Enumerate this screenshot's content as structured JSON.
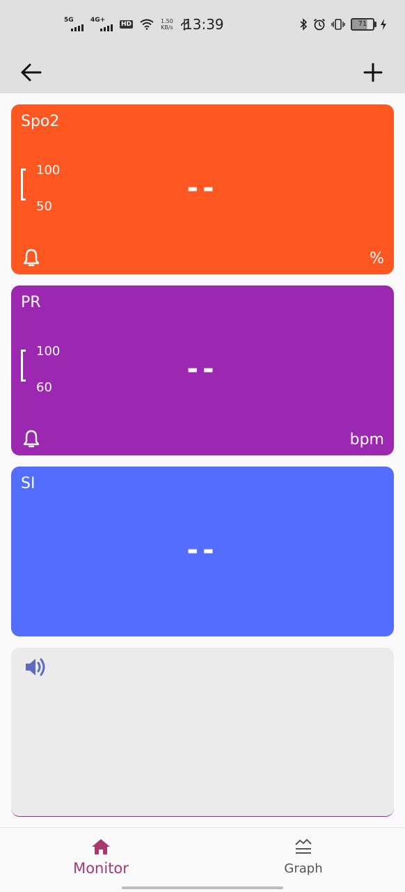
{
  "status_bar": {
    "time": "13:39",
    "network_1": "5G",
    "network_2": "4G+",
    "hd_label": "HD",
    "speed_value": "1.50",
    "speed_unit": "KB/s",
    "battery": "71"
  },
  "app_bar": {
    "back_icon": "arrow-left-icon",
    "add_icon": "plus-icon"
  },
  "cards": [
    {
      "title": "Spo2",
      "range_high": "100",
      "range_low": "50",
      "value": "--",
      "unit": "%",
      "color": "#ff5722"
    },
    {
      "title": "PR",
      "range_high": "100",
      "range_low": "60",
      "value": "--",
      "unit": "bpm",
      "color": "#9c27b0"
    },
    {
      "title": "SI",
      "value": "--",
      "color": "#536dfe"
    }
  ],
  "audio_panel": {
    "icon": "speaker-icon",
    "icon_color": "#5c6bc0"
  },
  "bottom_nav": {
    "monitor_label": "Monitor",
    "graph_label": "Graph",
    "active_color": "#a8386e"
  }
}
